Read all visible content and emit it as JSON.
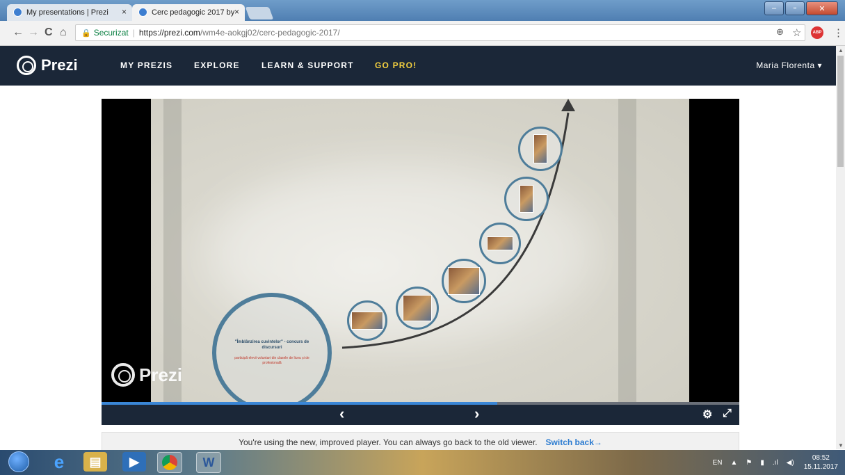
{
  "browser": {
    "tabs": [
      {
        "label": "My presentations | Prezi",
        "close": "×"
      },
      {
        "label": "Cerc pedagogic 2017 by",
        "close": "×"
      }
    ],
    "window_buttons": {
      "minimize": "–",
      "maximize": "▫",
      "close": "✕"
    },
    "nav": {
      "back": "←",
      "forward": "→",
      "reload": "C",
      "home": "⌂"
    },
    "address": {
      "secure_label": "Securizat",
      "url_host": "https://prezi.com",
      "url_path": "/wm4e-aokgj02/cerc-pedagogic-2017/"
    },
    "toolbar_right": {
      "zoom": "⊕",
      "star": "☆",
      "adblock": "ABP",
      "menu": "⋮"
    }
  },
  "prezi_nav": {
    "logo": "Prezi",
    "items": [
      "MY PREZIS",
      "EXPLORE",
      "LEARN & SUPPORT",
      "GO PRO!"
    ],
    "user": "Maria Florenta"
  },
  "presentation": {
    "title_circle": {
      "title": "\"Îmblânzirea cuvintelor\" - concurs de discursuri",
      "subtitle": "participă elevii voluntari din clasele de liceu și de profesională"
    },
    "watermark": "Prezi",
    "progress": 0.62
  },
  "controls": {
    "prev": "‹",
    "next": "›",
    "settings": "⚙",
    "fullscreen": "⤢"
  },
  "notice": {
    "text": "You're using the new, improved player. You can always go back to the old viewer.",
    "link": "Switch back→"
  },
  "taskbar": {
    "tray": {
      "lang": "EN",
      "time": "08:52",
      "date": "15.11.2017"
    }
  },
  "colors": {
    "nav_bg": "#1b2738",
    "accent_pro": "#f4d03f",
    "progress": "#3a86d6",
    "circle_border": "#4e7d9a"
  }
}
